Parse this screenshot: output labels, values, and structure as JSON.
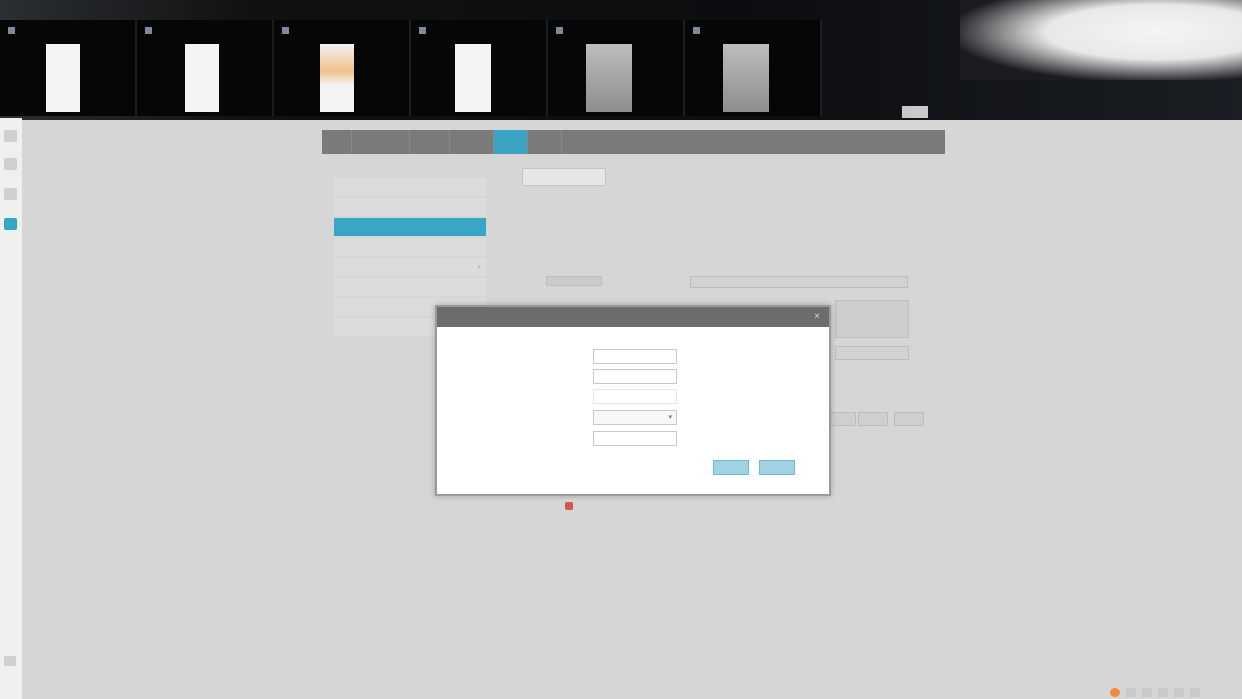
{
  "switcher": {
    "windows": [
      {
        "title": "",
        "preview": "white"
      },
      {
        "title": "",
        "preview": "white"
      },
      {
        "title": "",
        "preview": "orange"
      },
      {
        "title": "",
        "preview": "white2"
      },
      {
        "title": "",
        "preview": "grey"
      },
      {
        "title": "",
        "preview": "grey"
      }
    ]
  },
  "header": {
    "admin_text": "",
    "logout_label": ""
  },
  "nav": {
    "tabs": [
      {
        "label": ""
      },
      {
        "label": ""
      },
      {
        "label": ""
      },
      {
        "label": ""
      },
      {
        "label": "",
        "active": true
      },
      {
        "label": ""
      }
    ]
  },
  "side_menu": {
    "heading": "",
    "items": [
      {
        "label": ""
      },
      {
        "label": ""
      },
      {
        "label": "",
        "active": true
      },
      {
        "label": ""
      },
      {
        "label": ""
      },
      {
        "label": ""
      },
      {
        "label": ""
      },
      {
        "label": ""
      }
    ]
  },
  "content": {
    "tab_label": "",
    "description": ""
  },
  "dialog": {
    "title": "",
    "fields": [
      {
        "label": "",
        "value": "",
        "type": "input"
      },
      {
        "label": "",
        "value": "",
        "type": "input"
      },
      {
        "label": "",
        "value": "",
        "type": "input"
      },
      {
        "label": "",
        "value": "",
        "type": "select"
      },
      {
        "label": "",
        "value": "",
        "type": "input"
      }
    ],
    "ok_label": "",
    "cancel_label": ""
  },
  "hint": {
    "text": ""
  },
  "colors": {
    "accent": "#3aa4c2",
    "nav_bg": "#7a7a7a",
    "dialog_header": "#6d6d6d",
    "error": "#d9534f"
  }
}
